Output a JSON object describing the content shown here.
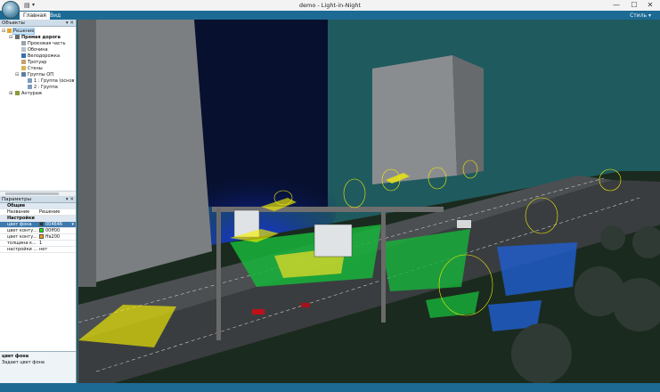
{
  "window": {
    "title": "demo - Light-in-Night",
    "minimize_glyph": "—",
    "maximize_glyph": "☐",
    "close_glyph": "✕"
  },
  "ribbon": {
    "tabs": [
      {
        "label": "Главная",
        "active": true
      },
      {
        "label": "Вид",
        "active": false
      }
    ],
    "style_menu": "Стиль"
  },
  "objects_panel": {
    "title": "Объекты",
    "tree": [
      {
        "label": "Решение",
        "level": 0,
        "selected": true,
        "icon": "solution-icon"
      },
      {
        "label": "Прямая дорога",
        "level": 1,
        "bold": true,
        "icon": "road-icon"
      },
      {
        "label": "Проезжая часть",
        "level": 2,
        "icon": "carriageway-icon"
      },
      {
        "label": "Обочина",
        "level": 2,
        "icon": "roadside-icon"
      },
      {
        "label": "Велодорожка",
        "level": 2,
        "icon": "bike-lane-icon"
      },
      {
        "label": "Тротуар",
        "level": 2,
        "icon": "sidewalk-icon"
      },
      {
        "label": "Стены",
        "level": 2,
        "icon": "walls-icon"
      },
      {
        "label": "Группы ОП",
        "level": 2,
        "icon": "luminaire-groups-icon"
      },
      {
        "label": "1 : Группа (основ",
        "level": 3,
        "icon": "group-icon"
      },
      {
        "label": "2 : Группа",
        "level": 3,
        "icon": "group-icon"
      },
      {
        "label": "Антураж",
        "level": 1,
        "icon": "scenery-icon"
      }
    ]
  },
  "params_panel": {
    "title": "Параметры",
    "categories": [
      {
        "name": "Общие",
        "rows": [
          {
            "key": "Название",
            "value": "Решение"
          }
        ]
      },
      {
        "name": "Настройки",
        "rows": [
          {
            "key": "цвет фона",
            "value": "004646",
            "swatch": "#004646",
            "selected": true,
            "has_dropdown": true
          },
          {
            "key": "цвет конту...",
            "value": "00ff00",
            "swatch": "#00ff00"
          },
          {
            "key": "цвет конту...",
            "value": "ffa200",
            "swatch": "#ffa200"
          },
          {
            "key": "толщина к...",
            "value": "1"
          },
          {
            "key": "настройки ...",
            "value": "нет"
          }
        ]
      }
    ],
    "description_title": "цвет фона",
    "description_text": "Задает цвет фона"
  },
  "colors": {
    "accent": "#1d6b94",
    "viewport_bg": "#1f5a5f"
  }
}
